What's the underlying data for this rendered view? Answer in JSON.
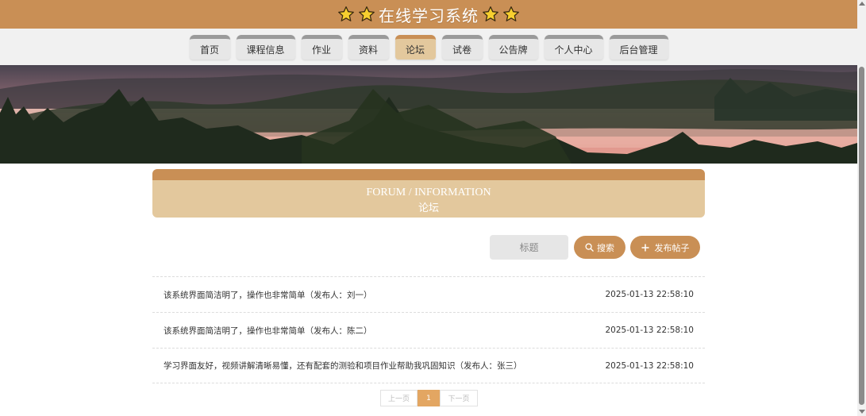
{
  "header": {
    "title": "在线学习系统"
  },
  "nav": {
    "items": [
      {
        "label": "首页",
        "width": 51
      },
      {
        "label": "课程信息",
        "width": 74
      },
      {
        "label": "作业",
        "width": 51
      },
      {
        "label": "资料",
        "width": 51
      },
      {
        "label": "论坛",
        "width": 51,
        "active": true
      },
      {
        "label": "试卷",
        "width": 51
      },
      {
        "label": "公告牌",
        "width": 62
      },
      {
        "label": "个人中心",
        "width": 74
      },
      {
        "label": "后台管理",
        "width": 74
      }
    ]
  },
  "section": {
    "title_en": "FORUM / INFORMATION",
    "title_zh": "论坛"
  },
  "search": {
    "placeholder": "标题",
    "search_label": "搜索",
    "post_label": "发布帖子"
  },
  "posts": [
    {
      "title": "该系统界面简洁明了，操作也非常简单（发布人：刘一）",
      "date": "2025-01-13 22:58:10"
    },
    {
      "title": "该系统界面简洁明了，操作也非常简单（发布人：陈二）",
      "date": "2025-01-13 22:58:10"
    },
    {
      "title": "学习界面友好，视频讲解清晰易懂，还有配套的测验和项目作业帮助我巩固知识（发布人：张三）",
      "date": "2025-01-13 22:58:10"
    }
  ],
  "pagination": {
    "prev": "上一页",
    "current": "1",
    "next": "下一页"
  },
  "colors": {
    "accent": "#c98f55",
    "accent_light": "#e3c89d",
    "nav_bg": "#f1f1f1"
  }
}
